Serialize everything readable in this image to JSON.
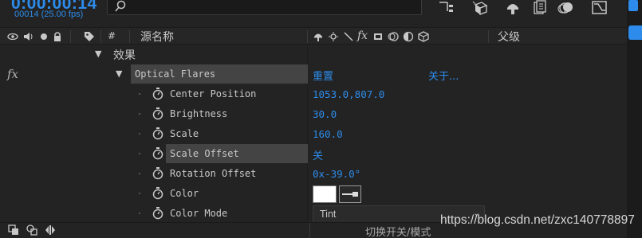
{
  "top": {
    "timecode": "0:00:00:14",
    "fps": "00014 (25.00 fps)",
    "search_placeholder": ""
  },
  "header": {
    "hash": "#",
    "source_name": "源名称",
    "fx_symbol": "fx",
    "parent": "父级"
  },
  "effects_group": {
    "label": "效果"
  },
  "effect": {
    "fx_symbol": "fx",
    "name": "Optical Flares",
    "reset": "重置",
    "about": "关于..."
  },
  "properties": [
    {
      "name": "Center Position",
      "value": "1053.0,807.0"
    },
    {
      "name": "Brightness",
      "value": "30.0"
    },
    {
      "name": "Scale",
      "value": "160.0"
    },
    {
      "name": "Scale Offset",
      "value": "关"
    },
    {
      "name": "Rotation Offset",
      "value": "0x-39.0°"
    },
    {
      "name": "Color",
      "value": "#ffffff"
    },
    {
      "name": "Color Mode",
      "value": "Tint"
    }
  ],
  "footer": {
    "toggle_label": "切换开关/模式"
  },
  "watermark": "https://blog.csdn.net/zxc140778897",
  "colors": {
    "accent": "#2d8ceb",
    "panel": "#232323",
    "highlight": "#444444",
    "text": "#c8c8c8"
  }
}
